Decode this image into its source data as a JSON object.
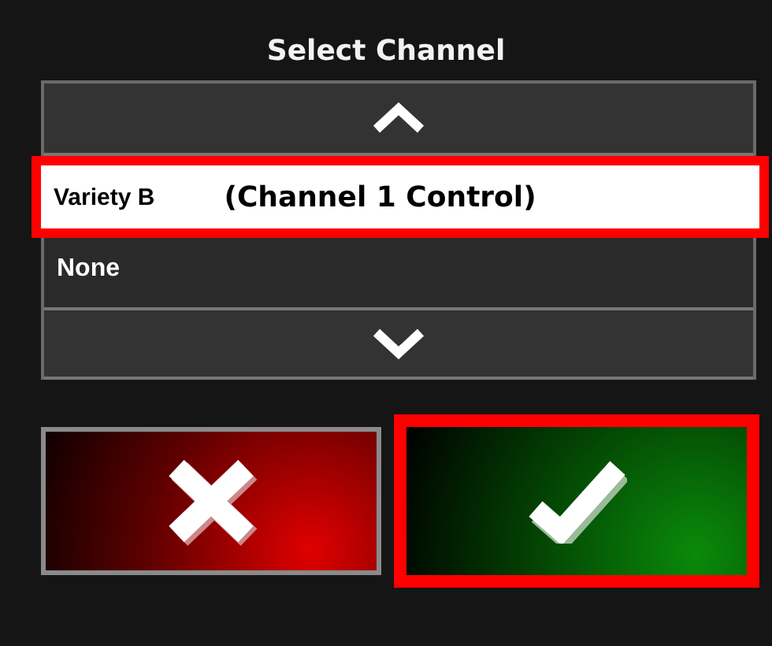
{
  "dialog": {
    "title": "Select Channel"
  },
  "options": [
    {
      "label": "Variety B",
      "note": "(Channel 1 Control)",
      "selected": true,
      "highlighted": true
    },
    {
      "label": "None",
      "selected": false,
      "highlighted": false
    }
  ],
  "buttons": [
    {
      "kind": "cancel",
      "highlighted": false
    },
    {
      "kind": "confirm",
      "highlighted": true
    }
  ]
}
